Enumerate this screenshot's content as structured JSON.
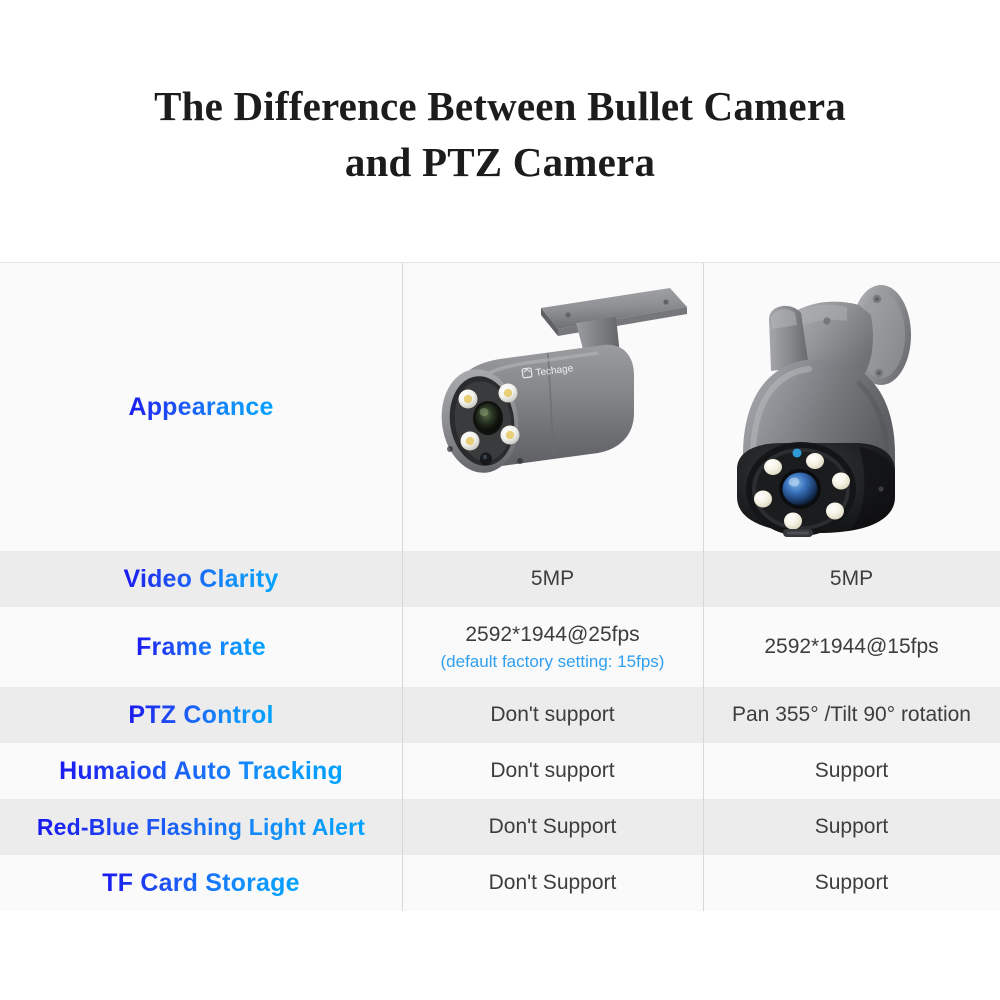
{
  "page": {
    "title_line_1": "The Difference Between Bullet Camera",
    "title_line_2": "and PTZ Camera",
    "accent_blue_start": "#1a18f0",
    "accent_blue_end": "#00a4ff",
    "note_blue": "#2f9ff0",
    "row_light_bg": "#fafafa",
    "row_shaded_bg": "#ececec",
    "divider_color": "#d8d8d8",
    "body_text_color": "#3d3d3d"
  },
  "table": {
    "columns": [
      {
        "key": "feature",
        "label": ""
      },
      {
        "key": "bullet",
        "label": "Bullet Camera"
      },
      {
        "key": "ptz",
        "label": "PTZ Camera"
      }
    ],
    "rows": [
      {
        "feature": "Appearance",
        "bullet": "bullet-camera-image",
        "ptz": "ptz-camera-image",
        "type": "image"
      },
      {
        "feature": "Video Clarity",
        "bullet": "5MP",
        "ptz": "5MP",
        "type": "text"
      },
      {
        "feature": "Frame rate",
        "bullet": "2592*1944@25fps",
        "bullet_note": "(default factory setting: 15fps)",
        "ptz": "2592*1944@15fps",
        "type": "text"
      },
      {
        "feature": "PTZ Control",
        "bullet": "Don't support",
        "ptz": "Pan 355° /Tilt 90° rotation",
        "type": "text"
      },
      {
        "feature": "Humaiod Auto Tracking",
        "bullet": "Don't support",
        "ptz": "Support",
        "type": "text"
      },
      {
        "feature": "Red-Blue Flashing Light Alert",
        "bullet": "Don't Support",
        "ptz": "Support",
        "type": "text"
      },
      {
        "feature": "TF Card Storage",
        "bullet": "Don't Support",
        "ptz": "Support",
        "type": "text"
      }
    ]
  },
  "images": {
    "bullet_camera": {
      "brand_text": "Techage",
      "body_color": "#7b7d80",
      "led_count": 4
    },
    "ptz_camera": {
      "dome_color": "#8a8c8f",
      "module_color": "#1d1e20",
      "led_count": 6,
      "lens_color": "#2f6fb5"
    }
  }
}
